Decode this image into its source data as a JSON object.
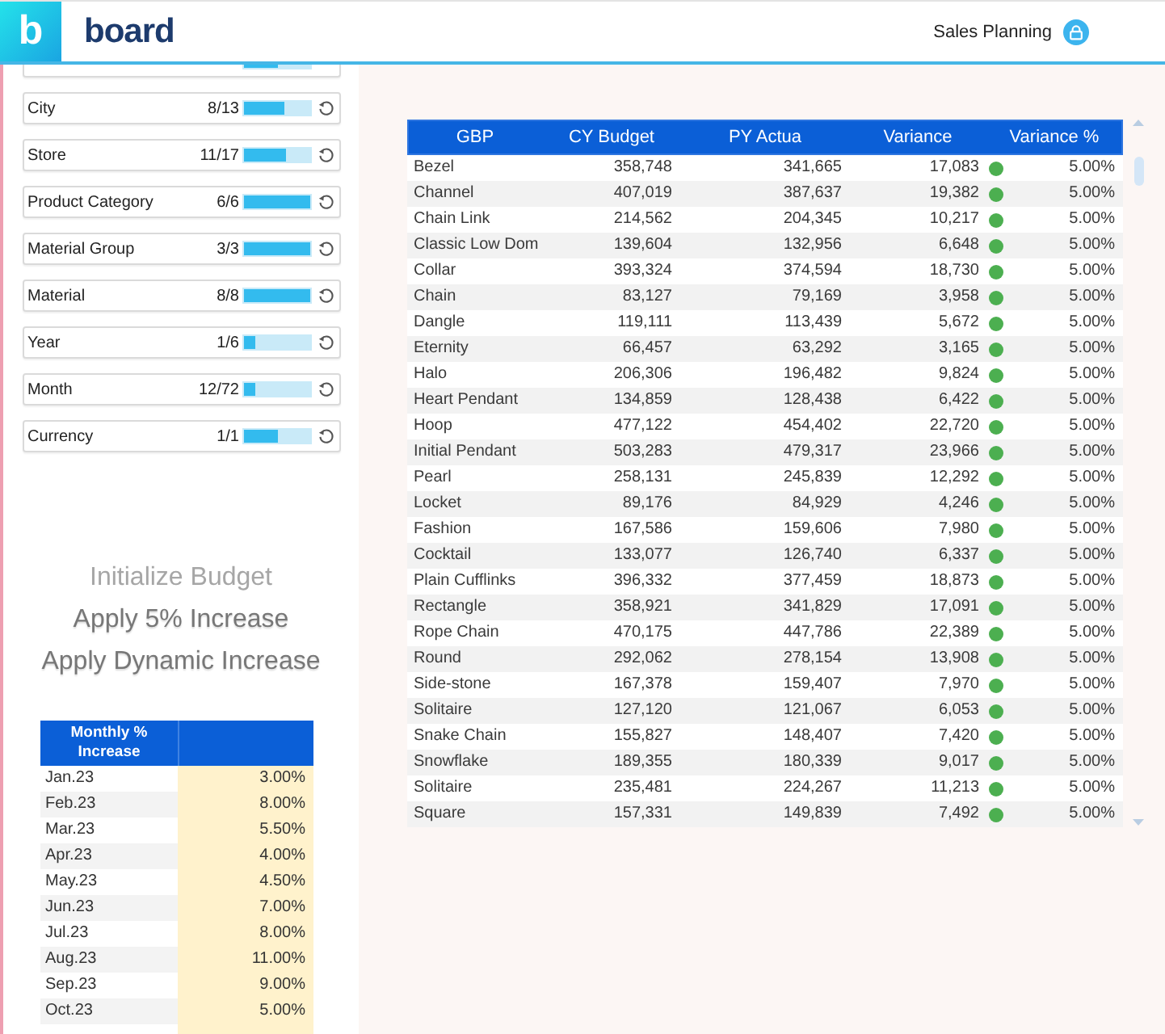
{
  "header": {
    "logo_mark": "b",
    "brand": "board",
    "title": "Sales Planning"
  },
  "filters": [
    {
      "kind": "partial",
      "level": 0.5
    },
    {
      "kind": "full",
      "label": "City",
      "count": "8/13",
      "level": 0.6
    },
    {
      "kind": "full",
      "label": "Store",
      "count": "11/17",
      "level": 0.63
    },
    {
      "kind": "full",
      "label": "Product Category",
      "count": "6/6",
      "level": 1
    },
    {
      "kind": "full",
      "label": "Material Group",
      "count": "3/3",
      "level": 1
    },
    {
      "kind": "full",
      "label": "Material",
      "count": "8/8",
      "level": 1
    },
    {
      "kind": "full",
      "label": "Year",
      "count": "1/6",
      "level": 0.16
    },
    {
      "kind": "full",
      "label": "Month",
      "count": "12/72",
      "level": 0.16
    },
    {
      "kind": "full",
      "label": "Currency",
      "count": "1/1",
      "level": 0.5
    }
  ],
  "actions": [
    {
      "label": "Initialize Budget",
      "disabled": true
    },
    {
      "label": "Apply 5% Increase",
      "disabled": false
    },
    {
      "label": "Apply Dynamic Increase",
      "disabled": false
    }
  ],
  "increase_table": {
    "header": "Monthly % Increase",
    "rows": [
      {
        "month": "Jan.23",
        "value": "3.00%"
      },
      {
        "month": "Feb.23",
        "value": "8.00%"
      },
      {
        "month": "Mar.23",
        "value": "5.50%"
      },
      {
        "month": "Apr.23",
        "value": "4.00%"
      },
      {
        "month": "May.23",
        "value": "4.50%"
      },
      {
        "month": "Jun.23",
        "value": "7.00%"
      },
      {
        "month": "Jul.23",
        "value": "8.00%"
      },
      {
        "month": "Aug.23",
        "value": "11.00%"
      },
      {
        "month": "Sep.23",
        "value": "9.00%"
      },
      {
        "month": "Oct.23",
        "value": "5.00%"
      }
    ]
  },
  "budget_table": {
    "columns": [
      "GBP",
      "CY Budget",
      "PY Actua",
      "Variance",
      "Variance %"
    ],
    "rows": [
      {
        "cells": [
          "Bezel",
          "358,748",
          "341,665",
          "17,083",
          "5.00%"
        ],
        "color": "#4caf50"
      },
      {
        "cells": [
          "Channel",
          "407,019",
          "387,637",
          "19,382",
          "5.00%"
        ],
        "color": "#4caf50"
      },
      {
        "cells": [
          "Chain Link",
          "214,562",
          "204,345",
          "10,217",
          "5.00%"
        ],
        "color": "#4caf50"
      },
      {
        "cells": [
          "Classic Low Dom",
          "139,604",
          "132,956",
          "6,648",
          "5.00%"
        ],
        "color": "#4caf50"
      },
      {
        "cells": [
          "Collar",
          "393,324",
          "374,594",
          "18,730",
          "5.00%"
        ],
        "color": "#4caf50"
      },
      {
        "cells": [
          "Chain",
          "83,127",
          "79,169",
          "3,958",
          "5.00%"
        ],
        "color": "#4caf50"
      },
      {
        "cells": [
          "Dangle",
          "119,111",
          "113,439",
          "5,672",
          "5.00%"
        ],
        "color": "#4caf50"
      },
      {
        "cells": [
          "Eternity",
          "66,457",
          "63,292",
          "3,165",
          "5.00%"
        ],
        "color": "#4caf50"
      },
      {
        "cells": [
          "Halo",
          "206,306",
          "196,482",
          "9,824",
          "5.00%"
        ],
        "color": "#4caf50"
      },
      {
        "cells": [
          "Heart Pendant",
          "134,859",
          "128,438",
          "6,422",
          "5.00%"
        ],
        "color": "#4caf50"
      },
      {
        "cells": [
          "Hoop",
          "477,122",
          "454,402",
          "22,720",
          "5.00%"
        ],
        "color": "#4caf50"
      },
      {
        "cells": [
          "Initial Pendant",
          "503,283",
          "479,317",
          "23,966",
          "5.00%"
        ],
        "color": "#4caf50"
      },
      {
        "cells": [
          "Pearl",
          "258,131",
          "245,839",
          "12,292",
          "5.00%"
        ],
        "color": "#4caf50"
      },
      {
        "cells": [
          "Locket",
          "89,176",
          "84,929",
          "4,246",
          "5.00%"
        ],
        "color": "#4caf50"
      },
      {
        "cells": [
          "Fashion",
          "167,586",
          "159,606",
          "7,980",
          "5.00%"
        ],
        "color": "#4caf50"
      },
      {
        "cells": [
          "Cocktail",
          "133,077",
          "126,740",
          "6,337",
          "5.00%"
        ],
        "color": "#4caf50"
      },
      {
        "cells": [
          "Plain Cufflinks",
          "396,332",
          "377,459",
          "18,873",
          "5.00%"
        ],
        "color": "#4caf50"
      },
      {
        "cells": [
          "Rectangle",
          "358,921",
          "341,829",
          "17,091",
          "5.00%"
        ],
        "color": "#4caf50"
      },
      {
        "cells": [
          "Rope Chain",
          "470,175",
          "447,786",
          "22,389",
          "5.00%"
        ],
        "color": "#4caf50"
      },
      {
        "cells": [
          "Round",
          "292,062",
          "278,154",
          "13,908",
          "5.00%"
        ],
        "color": "#4caf50"
      },
      {
        "cells": [
          "Side-stone",
          "167,378",
          "159,407",
          "7,970",
          "5.00%"
        ],
        "color": "#4caf50"
      },
      {
        "cells": [
          "Solitaire",
          "127,120",
          "121,067",
          "6,053",
          "5.00%"
        ],
        "color": "#4caf50"
      },
      {
        "cells": [
          "Snake Chain",
          "155,827",
          "148,407",
          "7,420",
          "5.00%"
        ],
        "color": "#4caf50"
      },
      {
        "cells": [
          "Snowflake",
          "189,355",
          "180,339",
          "9,017",
          "5.00%"
        ],
        "color": "#4caf50"
      },
      {
        "cells": [
          "Solitaire",
          "235,481",
          "224,267",
          "11,213",
          "5.00%"
        ],
        "color": "#4caf50"
      },
      {
        "cells": [
          "Square",
          "157,331",
          "149,839",
          "7,492",
          "5.00%"
        ],
        "color": "#4caf50"
      }
    ]
  }
}
